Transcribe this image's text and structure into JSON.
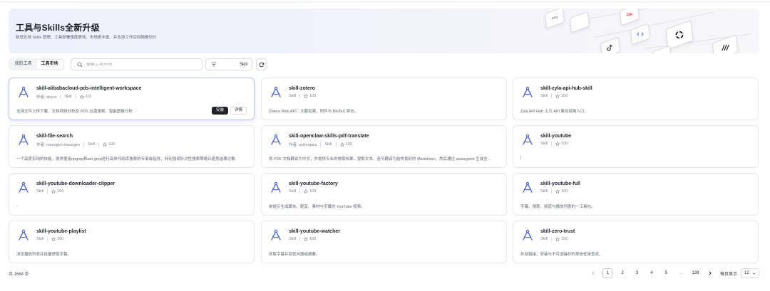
{
  "banner": {
    "title": "工具与Skills全新升级",
    "subtitle": "新增支持 Skills 管理、工具部署速度更快、市场更丰富、并支持工作空间隔离划分",
    "decor_labels": [
      "ZIP"
    ]
  },
  "tabs": [
    {
      "label": "我的工具",
      "active": false
    },
    {
      "label": "工具市场",
      "active": true
    }
  ],
  "search": {
    "placeholder": "搜索工具市场",
    "value": ""
  },
  "filter": {
    "label": "Skill"
  },
  "cards": [
    {
      "title": "skill-alibabacloud-pds-intelligent-workspace",
      "author": "作者: aliyun",
      "type": "Skill",
      "stars": "101",
      "description": "支持文件上传下载、文档视频分析及 PDS 云盘搜索、智能图像分析",
      "highlighted": true,
      "install_label": "安装",
      "detail_label": "详情"
    },
    {
      "title": "skill-zotero",
      "author": "",
      "type": "Skill",
      "stars": "100",
      "description": "Zotero Web API：文献检索、附件与 BibTeX 导出。"
    },
    {
      "title": "skill-zyla-api-hub-skill",
      "author": "",
      "type": "Skill",
      "stars": "100",
      "description": "Zyla API Hub 上万 API 聚合调用入口。"
    },
    {
      "title": "skill-file-search",
      "author": "作者: masogen-masogen",
      "type": "Skill",
      "stars": "100",
      "description": "一个高度实用的技能，提供使用ripgrep和ast-grep进行高效代码库搜索的专家级指导，特别强调针对性搜索策略以避免结果过载"
    },
    {
      "title": "skill-openclaw-skills-pdf-translate",
      "author": "作者: anthropics",
      "type": "Skill",
      "stars": "100",
      "description": "将 PDF 文档翻译为中文，并提供专业的排版效果。提取文本、逐节翻译为结构良好的 Markdown，然后通过 weasyprint 生成全..."
    },
    {
      "title": "skill-youtube",
      "author": "",
      "type": "Skill",
      "stars": "100",
      "description": "|"
    },
    {
      "title": "skill-youtube-downloader-clipper",
      "author": "",
      "type": "Skill",
      "stars": "100",
      "description": "-"
    },
    {
      "title": "skill-youtube-factory",
      "author": "",
      "type": "Skill",
      "stars": "100",
      "description": "单提示生成脚本、配音、素材与字幕的 YouTube 视频。"
    },
    {
      "title": "skill-youtube-full",
      "author": "",
      "type": "Skill",
      "stars": "100",
      "description": "字幕、搜索、频道与播放列表的一工具包。"
    },
    {
      "title": "skill-youtube-playlist",
      "author": "",
      "type": "Skill",
      "stars": "100",
      "description": "浏览播放列表并批量获取字幕。"
    },
    {
      "title": "skill-youtube-watcher",
      "author": "",
      "type": "Skill",
      "stars": "100",
      "description": "抓取字幕并回答问题或摘要。"
    },
    {
      "title": "skill-zero-trust",
      "author": "",
      "type": "Skill",
      "stars": "100",
      "description": "外部链接、安装与不可逆操作的零信任审查流。"
    }
  ],
  "footer": {
    "total": "共 1664 条",
    "pages": [
      "1",
      "2",
      "3",
      "4",
      "5",
      "...",
      "139"
    ],
    "current_page": "1",
    "page_size_label": "每页显示",
    "page_size": "12"
  },
  "colors": {
    "accent": "#4f6bd8",
    "primary_button": "#1f2329",
    "card_border": "#e6e8ec",
    "highlight_border": "#b8c2f0"
  },
  "icons": {
    "card": "compass-icon",
    "search": "search-icon",
    "filter": "filter-icon",
    "refresh": "refresh-icon",
    "star": "star-icon"
  }
}
